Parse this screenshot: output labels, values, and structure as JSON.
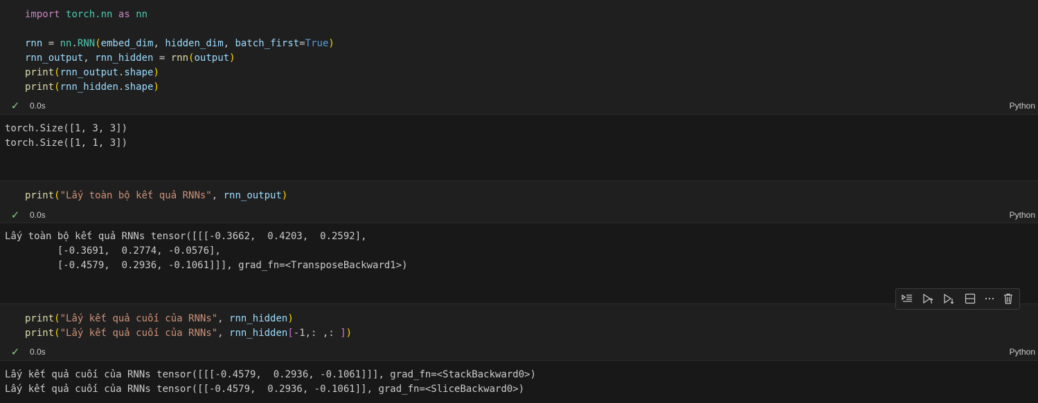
{
  "cells": [
    {
      "code": [
        [
          [
            "kw",
            "import"
          ],
          [
            "op",
            " "
          ],
          [
            "mod",
            "torch.nn"
          ],
          [
            "op",
            " "
          ],
          [
            "kw",
            "as"
          ],
          [
            "op",
            " "
          ],
          [
            "mod",
            "nn"
          ]
        ],
        [],
        [
          [
            "var",
            "rnn"
          ],
          [
            "op",
            " = "
          ],
          [
            "mod",
            "nn"
          ],
          [
            "op",
            "."
          ],
          [
            "mod",
            "RNN"
          ],
          [
            "p1",
            "("
          ],
          [
            "var",
            "embed_dim"
          ],
          [
            "op",
            ", "
          ],
          [
            "var",
            "hidden_dim"
          ],
          [
            "op",
            ", "
          ],
          [
            "var",
            "batch_first"
          ],
          [
            "op",
            "="
          ],
          [
            "bool",
            "True"
          ],
          [
            "p1",
            ")"
          ]
        ],
        [
          [
            "var",
            "rnn_output"
          ],
          [
            "op",
            ", "
          ],
          [
            "var",
            "rnn_hidden"
          ],
          [
            "op",
            " = "
          ],
          [
            "fn",
            "rnn"
          ],
          [
            "p1",
            "("
          ],
          [
            "var",
            "output"
          ],
          [
            "p1",
            ")"
          ]
        ],
        [
          [
            "fn",
            "print"
          ],
          [
            "p1",
            "("
          ],
          [
            "var",
            "rnn_output"
          ],
          [
            "op",
            "."
          ],
          [
            "var",
            "shape"
          ],
          [
            "p1",
            ")"
          ]
        ],
        [
          [
            "fn",
            "print"
          ],
          [
            "p1",
            "("
          ],
          [
            "var",
            "rnn_hidden"
          ],
          [
            "op",
            "."
          ],
          [
            "var",
            "shape"
          ],
          [
            "p1",
            ")"
          ]
        ]
      ],
      "duration": "0.0s",
      "language": "Python",
      "output": [
        "torch.Size([1, 3, 3])",
        "torch.Size([1, 1, 3])"
      ]
    },
    {
      "code": [
        [
          [
            "fn",
            "print"
          ],
          [
            "p1",
            "("
          ],
          [
            "str",
            "\"Lấy toàn bộ kết quả RNNs\""
          ],
          [
            "op",
            ", "
          ],
          [
            "var",
            "rnn_output"
          ],
          [
            "p1",
            ")"
          ]
        ]
      ],
      "duration": "0.0s",
      "language": "Python",
      "output": [
        "Lấy toàn bộ kết quả RNNs tensor([[[-0.3662,  0.4203,  0.2592],",
        "         [-0.3691,  0.2774, -0.0576],",
        "         [-0.4579,  0.2936, -0.1061]]], grad_fn=<TransposeBackward1>)"
      ]
    },
    {
      "code": [
        [
          [
            "fn",
            "print"
          ],
          [
            "p1",
            "("
          ],
          [
            "str",
            "\"Lấy kết quả cuối của RNNs\""
          ],
          [
            "op",
            ", "
          ],
          [
            "var",
            "rnn_hidden"
          ],
          [
            "p1",
            ")"
          ]
        ],
        [
          [
            "fn",
            "print"
          ],
          [
            "p1",
            "("
          ],
          [
            "str",
            "\"Lấy kết quả cuối của RNNs\""
          ],
          [
            "op",
            ", "
          ],
          [
            "var",
            "rnn_hidden"
          ],
          [
            "p2",
            "["
          ],
          [
            "op",
            "-1,: ,: "
          ],
          [
            "p2",
            "]"
          ],
          [
            "p1",
            ")"
          ]
        ]
      ],
      "duration": "0.0s",
      "language": "Python",
      "output": [
        "Lấy kết quả cuối của RNNs tensor([[[-0.4579,  0.2936, -0.1061]]], grad_fn=<StackBackward0>)",
        "Lấy kết quả cuối của RNNs tensor([[-0.4579,  0.2936, -0.1061]], grad_fn=<SliceBackward0>)"
      ]
    }
  ],
  "toolbar": {
    "buttons": [
      "run-by-line-icon",
      "execute-above-icon",
      "execute-below-icon",
      "split-cell-icon",
      "more-actions-icon",
      "delete-icon"
    ]
  },
  "colors": {
    "success": "#89d185",
    "background": "#1f1f1f",
    "output_background": "#181818"
  }
}
